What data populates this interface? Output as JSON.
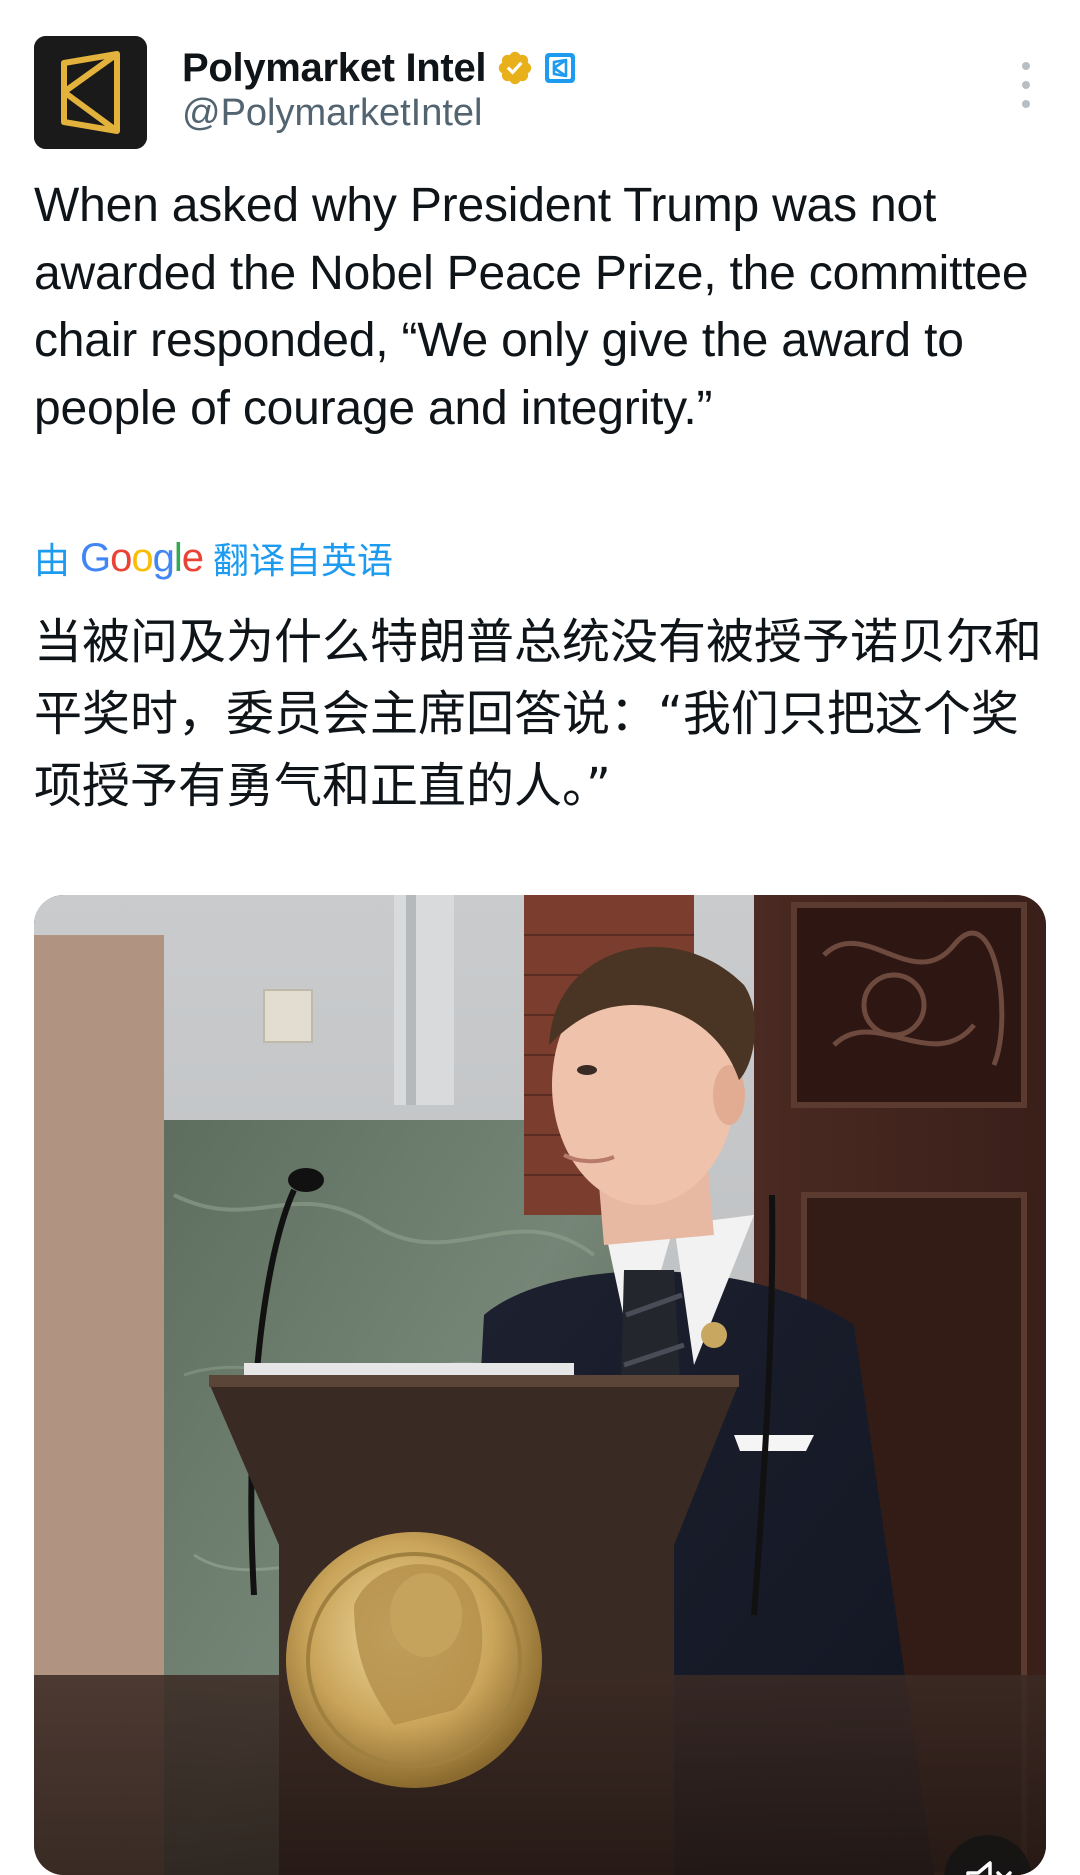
{
  "tweet": {
    "author": {
      "display_name": "Polymarket Intel",
      "handle": "@PolymarketIntel",
      "verified_badge_color": "#e8b01a",
      "affiliate_badge_color": "#1d9bf0"
    },
    "text": "When asked why President Trump was not awarded the Nobel Peace Prize, the committee chair responded, “We only give the award to people of courage and integrity.”",
    "translation": {
      "prefix": "由",
      "provider": "Google",
      "suffix": "翻译自英语",
      "text": "当被问及为什么特朗普总统没有被授予诺贝尔和平奖时，委员会主席回答说：“我们只把这个奖项授予有勇气和正直的人。”"
    },
    "media": {
      "type": "video",
      "muted": true
    }
  },
  "colors": {
    "accent": "#1d9bf0",
    "text_primary": "#0f1419",
    "text_secondary": "#536471"
  },
  "icons": {
    "more": "more-dots-icon",
    "verified": "verified-badge-icon",
    "affiliate": "affiliate-badge-icon",
    "mute": "mute-icon"
  }
}
